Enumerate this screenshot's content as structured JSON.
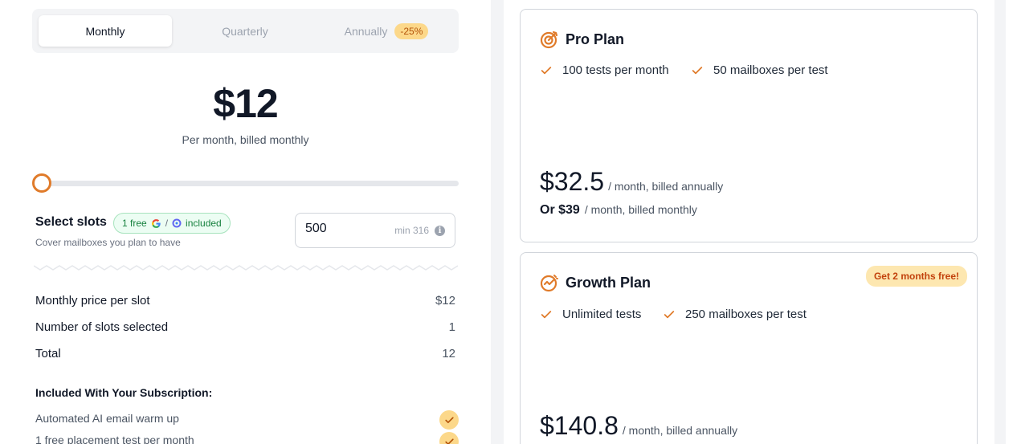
{
  "billing_toggle": {
    "options": [
      "Monthly",
      "Quarterly",
      "Annually"
    ],
    "selected": "Monthly",
    "annual_discount": "-25%"
  },
  "pricing": {
    "price": "$12",
    "caption": "Per month, billed monthly",
    "slider_fraction": 0
  },
  "slots": {
    "title": "Select slots",
    "free_badge_prefix": "1 free",
    "free_badge_suffix": "included",
    "subtitle": "Cover mailboxes you plan to have",
    "input_value": "500",
    "min_label": "min 316"
  },
  "summary": [
    {
      "label": "Monthly price per slot",
      "value": "$12"
    },
    {
      "label": "Number of slots selected",
      "value": "1"
    },
    {
      "label": "Total",
      "value": "12"
    }
  ],
  "included": {
    "title": "Included With Your Subscription:",
    "items": [
      "Automated AI email warm up",
      "1 free placement test per month"
    ]
  },
  "plans": [
    {
      "name": "Pro Plan",
      "perks": [
        "100 tests per month",
        "50 mailboxes per test"
      ],
      "price_annual": "$32.5",
      "annual_suffix": "/ month, billed annually",
      "price_monthly": "Or $39",
      "monthly_suffix": "/ month, billed monthly"
    },
    {
      "name": "Growth Plan",
      "promo": "Get 2 months free!",
      "perks": [
        "Unlimited tests",
        "250 mailboxes per test"
      ],
      "price_annual": "$140.8",
      "annual_suffix": "/ month, billed annually"
    }
  ],
  "colors": {
    "accent": "#e07b2a",
    "badge_bg": "#fcd88a",
    "free_green": "#15803d"
  }
}
